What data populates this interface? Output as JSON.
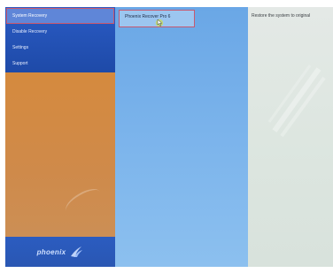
{
  "sidebar": {
    "items": [
      {
        "label": "System Recovery",
        "selected": true
      },
      {
        "label": "Disable Recovery",
        "selected": false
      },
      {
        "label": "Settings",
        "selected": false
      },
      {
        "label": "Support",
        "selected": false
      }
    ],
    "brand": {
      "name": "phoenix"
    }
  },
  "middle": {
    "header": "Phoenix Recover Pro 6"
  },
  "right": {
    "header": "Restore the system to original"
  },
  "colors": {
    "menu_blue": "#1e4aa8",
    "promo_orange": "#d58a3e",
    "middle_blue": "#7db5ec",
    "right_gray": "#dde6e0",
    "selection_outline": "#c9586e"
  },
  "icons": [
    "phoenix-logo-icon",
    "hand-cursor-icon"
  ]
}
